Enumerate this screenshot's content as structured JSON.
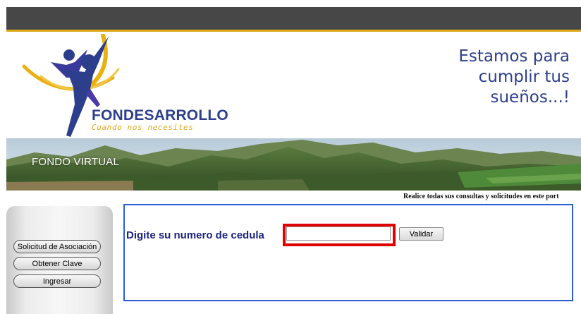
{
  "header": {
    "brand_name": "FONDESARROLLO",
    "brand_subtitle": "Cuando nos necesites",
    "slogan_line1": "Estamos para",
    "slogan_line2": "cumplir tus",
    "slogan_line3": "sueños...!",
    "bar_color": "#474747",
    "accent_color": "#e0a817",
    "brand_color": "#2d3e8c"
  },
  "banner": {
    "label": "FONDO VIRTUAL"
  },
  "tagline": "Realice todas sus consultas y solicitudes en este port",
  "sidebar": {
    "buttons": [
      {
        "label": "Solicitud de Asociación"
      },
      {
        "label": "Obtener Clave"
      },
      {
        "label": "Ingresar"
      }
    ]
  },
  "form": {
    "label": "Digite su numero de cedula",
    "cedula_value": "",
    "submit_label": "Validar",
    "highlight_color": "#e00000",
    "border_color": "#2a5fd8"
  }
}
